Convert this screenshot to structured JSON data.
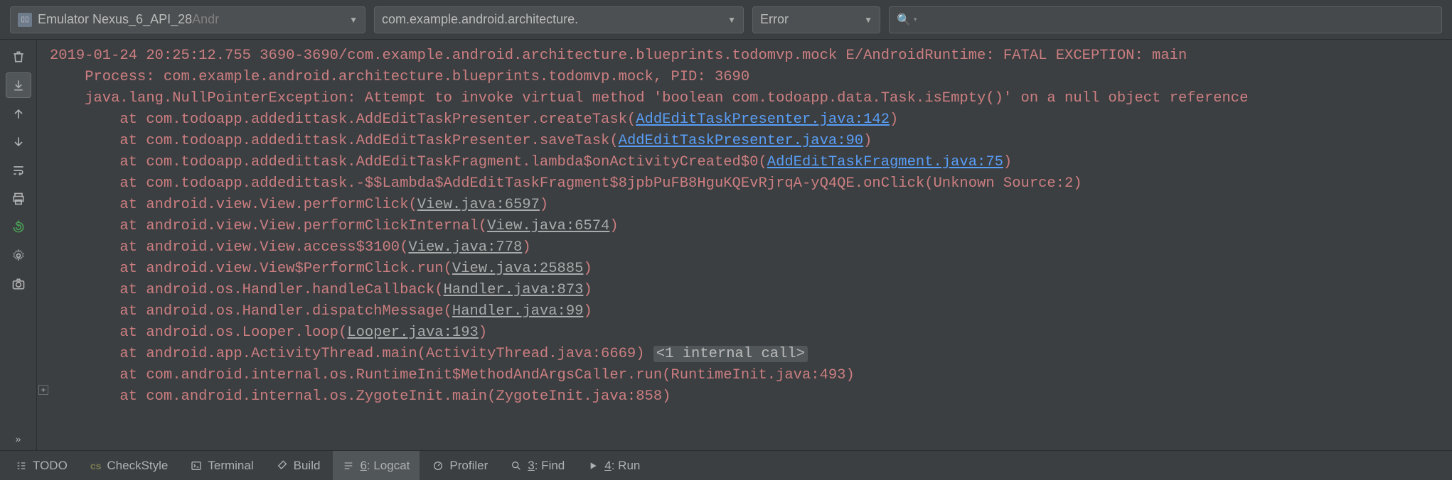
{
  "toolbar": {
    "device_label": "Emulator Nexus_6_API_28",
    "device_suffix": " Andr",
    "package_label": "com.example.android.architecture.",
    "level_label": "Error",
    "search_placeholder": ""
  },
  "log": {
    "header": "2019-01-24 20:25:12.755 3690-3690/com.example.android.architecture.blueprints.todomvp.mock E/AndroidRuntime: FATAL EXCEPTION: main",
    "process": "    Process: com.example.android.architecture.blueprints.todomvp.mock, PID: 3690",
    "exception": "    java.lang.NullPointerException: Attempt to invoke virtual method 'boolean com.todoapp.data.Task.isEmpty()' on a null object reference",
    "frames": [
      {
        "prefix": "        at com.todoapp.addedittask.AddEditTaskPresenter.createTask(",
        "link": "AddEditTaskPresenter.java:142",
        "link_class": "link-blue",
        "suffix": ")"
      },
      {
        "prefix": "        at com.todoapp.addedittask.AddEditTaskPresenter.saveTask(",
        "link": "AddEditTaskPresenter.java:90",
        "link_class": "link-blue",
        "suffix": ")"
      },
      {
        "prefix": "        at com.todoapp.addedittask.AddEditTaskFragment.lambda$onActivityCreated$0(",
        "link": "AddEditTaskFragment.java:75",
        "link_class": "link-blue",
        "suffix": ")"
      },
      {
        "prefix": "        at com.todoapp.addedittask.-$$Lambda$AddEditTaskFragment$8jpbPuFB8HguKQEvRjrqA-yQ4QE.onClick(Unknown Source:2)",
        "link": "",
        "link_class": "",
        "suffix": ""
      },
      {
        "prefix": "        at android.view.View.performClick(",
        "link": "View.java:6597",
        "link_class": "link-gray",
        "suffix": ")"
      },
      {
        "prefix": "        at android.view.View.performClickInternal(",
        "link": "View.java:6574",
        "link_class": "link-gray",
        "suffix": ")"
      },
      {
        "prefix": "        at android.view.View.access$3100(",
        "link": "View.java:778",
        "link_class": "link-gray",
        "suffix": ")"
      },
      {
        "prefix": "        at android.view.View$PerformClick.run(",
        "link": "View.java:25885",
        "link_class": "link-gray",
        "suffix": ")"
      },
      {
        "prefix": "        at android.os.Handler.handleCallback(",
        "link": "Handler.java:873",
        "link_class": "link-gray",
        "suffix": ")"
      },
      {
        "prefix": "        at android.os.Handler.dispatchMessage(",
        "link": "Handler.java:99",
        "link_class": "link-gray",
        "suffix": ")"
      },
      {
        "prefix": "        at android.os.Looper.loop(",
        "link": "Looper.java:193",
        "link_class": "link-gray",
        "suffix": ")"
      },
      {
        "prefix": "        at android.app.ActivityThread.main(ActivityThread.java:6669) ",
        "link": "",
        "link_class": "",
        "suffix": "",
        "internal": "<1 internal call>"
      },
      {
        "prefix": "        at com.android.internal.os.RuntimeInit$MethodAndArgsCaller.run(RuntimeInit.java:493)",
        "link": "",
        "link_class": "",
        "suffix": ""
      },
      {
        "prefix": "        at com.android.internal.os.ZygoteInit.main(ZygoteInit.java:858)",
        "link": "",
        "link_class": "",
        "suffix": ""
      }
    ]
  },
  "bottom": {
    "todo": "TODO",
    "checkstyle": "CheckStyle",
    "terminal": "Terminal",
    "build": "Build",
    "logcat_pre": "6",
    "logcat_post": ": Logcat",
    "profiler": "Profiler",
    "find_pre": "3",
    "find_post": ": Find",
    "run_pre": "4",
    "run_post": ": Run"
  }
}
